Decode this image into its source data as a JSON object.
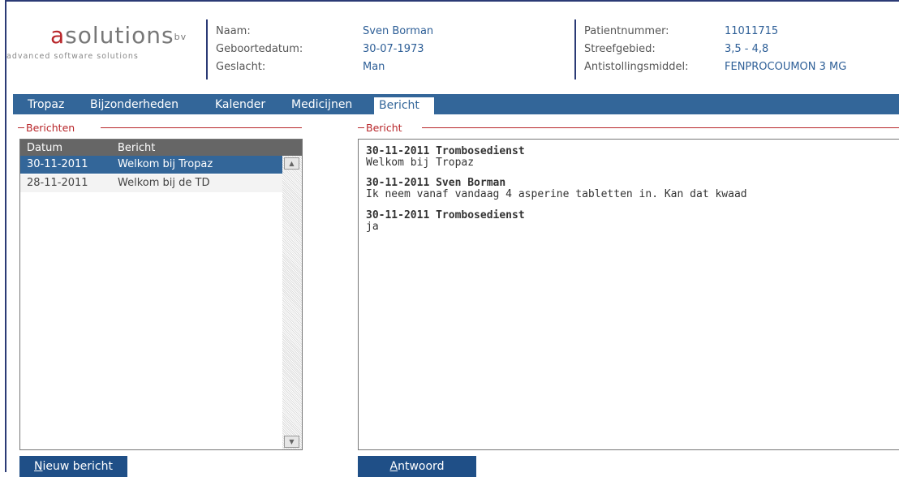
{
  "logo": {
    "brand": "solutions",
    "brand_first": "a",
    "brand_sup": "bv",
    "tagline": "advanced software solutions"
  },
  "patient": {
    "left": [
      {
        "label": "Naam:",
        "value": "Sven Borman"
      },
      {
        "label": "Geboortedatum:",
        "value": "30-07-1973"
      },
      {
        "label": "Geslacht:",
        "value": "Man"
      }
    ],
    "right": [
      {
        "label": "Patientnummer:",
        "value": "11011715"
      },
      {
        "label": "Streefgebied:",
        "value": "3,5 - 4,8"
      },
      {
        "label": "Antistollingsmiddel:",
        "value": "FENPROCOUMON 3 MG"
      }
    ]
  },
  "tabs": [
    "Tropaz",
    "Bijzonderheden",
    "Kalender",
    "Medicijnen",
    "Bericht"
  ],
  "active_tab": "Bericht",
  "berichten": {
    "legend": "Berichten",
    "columns": [
      "Datum",
      "Bericht"
    ],
    "rows": [
      {
        "datum": "30-11-2011",
        "bericht": "Welkom bij Tropaz",
        "selected": true
      },
      {
        "datum": "28-11-2011",
        "bericht": "Welkom bij de TD",
        "selected": false
      }
    ],
    "button": {
      "accel": "N",
      "rest": "ieuw bericht"
    }
  },
  "bericht": {
    "legend": "Bericht",
    "messages": [
      {
        "header": "30-11-2011 Trombosedienst",
        "body": "Welkom bij Tropaz"
      },
      {
        "header": "30-11-2011 Sven Borman",
        "body": "Ik neem vanaf vandaag 4 asperine tabletten in. Kan dat kwaad"
      },
      {
        "header": "30-11-2011 Trombosedienst",
        "body": "ja"
      }
    ],
    "button": {
      "accel": "A",
      "rest": "ntwoord"
    }
  },
  "colors": {
    "accent": "#336699",
    "legend": "#b8262a",
    "button": "#1f4f87"
  }
}
